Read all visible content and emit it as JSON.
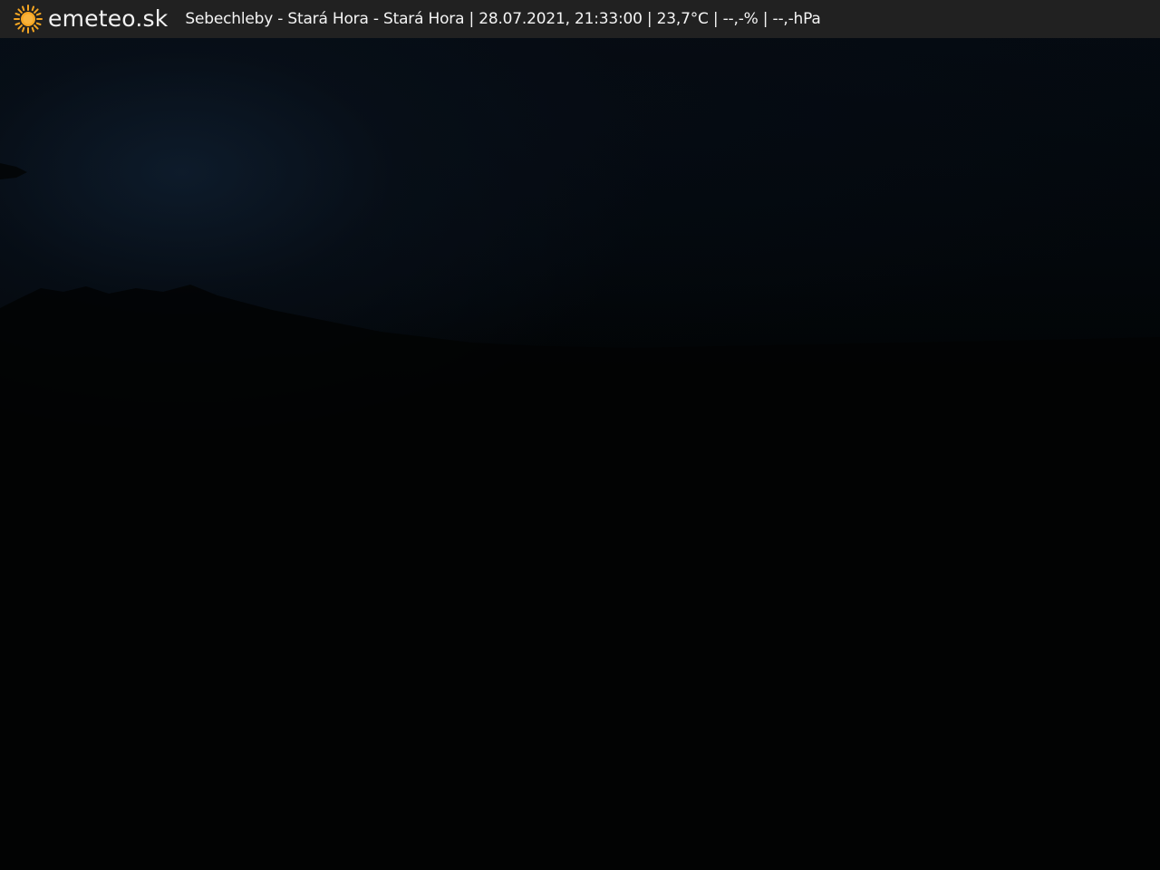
{
  "header": {
    "logo_icon": "sun-icon",
    "brand": "emeteo.sk",
    "info": "Sebechleby - Stará Hora - Stará Hora | 28.07.2021, 21:33:00 | 23,7°C | --,-% | --,-hPa"
  },
  "colors": {
    "header_bg": "#212121",
    "sun": "#f5a623",
    "sky": "#0a1624"
  }
}
